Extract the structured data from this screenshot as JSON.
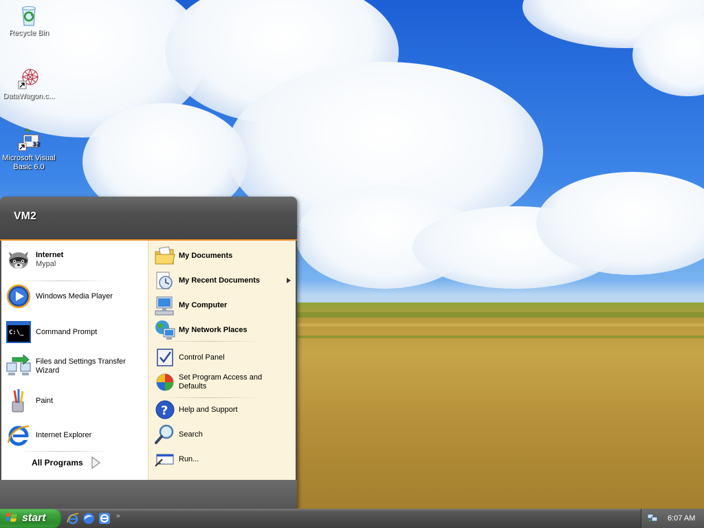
{
  "desktop": {
    "icons": [
      {
        "label": "Recycle Bin",
        "icon": "recycle-bin-icon"
      },
      {
        "label": "DataWagon.c...",
        "icon": "datawagon-shortcut-icon"
      },
      {
        "label": "Microsoft Visual Basic 6.0",
        "icon": "visual-basic-shortcut-icon"
      }
    ]
  },
  "start_menu": {
    "user_name": "VM2",
    "pinned": [
      {
        "label": "Internet",
        "sublabel": "Mypal",
        "icon": "mypal-raccoon-icon"
      }
    ],
    "recent": [
      {
        "label": "Windows Media Player",
        "icon": "media-player-icon"
      },
      {
        "label": "Command Prompt",
        "icon": "command-prompt-icon"
      },
      {
        "label": "Files and Settings Transfer Wizard",
        "icon": "transfer-wizard-icon"
      },
      {
        "label": "Paint",
        "icon": "paint-icon"
      },
      {
        "label": "Internet Explorer",
        "icon": "internet-explorer-icon"
      }
    ],
    "all_programs_label": "All Programs",
    "places": [
      {
        "label": "My Documents",
        "icon": "folder-documents-icon"
      },
      {
        "label": "My Recent Documents",
        "icon": "recent-documents-icon",
        "has_submenu": true
      },
      {
        "label": "My Computer",
        "icon": "computer-icon"
      },
      {
        "label": "My Network Places",
        "icon": "network-places-icon"
      }
    ],
    "settings": [
      {
        "label": "Control Panel",
        "icon": "control-panel-icon"
      },
      {
        "label": "Set Program Access and Defaults",
        "icon": "program-access-icon"
      }
    ],
    "tools": [
      {
        "label": "Help and Support",
        "icon": "help-icon"
      },
      {
        "label": "Search",
        "icon": "search-icon"
      },
      {
        "label": "Run...",
        "icon": "run-icon"
      }
    ]
  },
  "taskbar": {
    "start_label": "start",
    "quick_launch": [
      "internet-explorer-icon",
      "mypal-browser-icon",
      "ie-alt-icon"
    ],
    "more_glyph": "»",
    "clock": "6:07 AM"
  },
  "colors": {
    "accent_orange": "#e98e2a",
    "start_green": "#3ea33e",
    "menu_left_bg": "#ffffff",
    "menu_right_bg": "#fbf3dc"
  }
}
